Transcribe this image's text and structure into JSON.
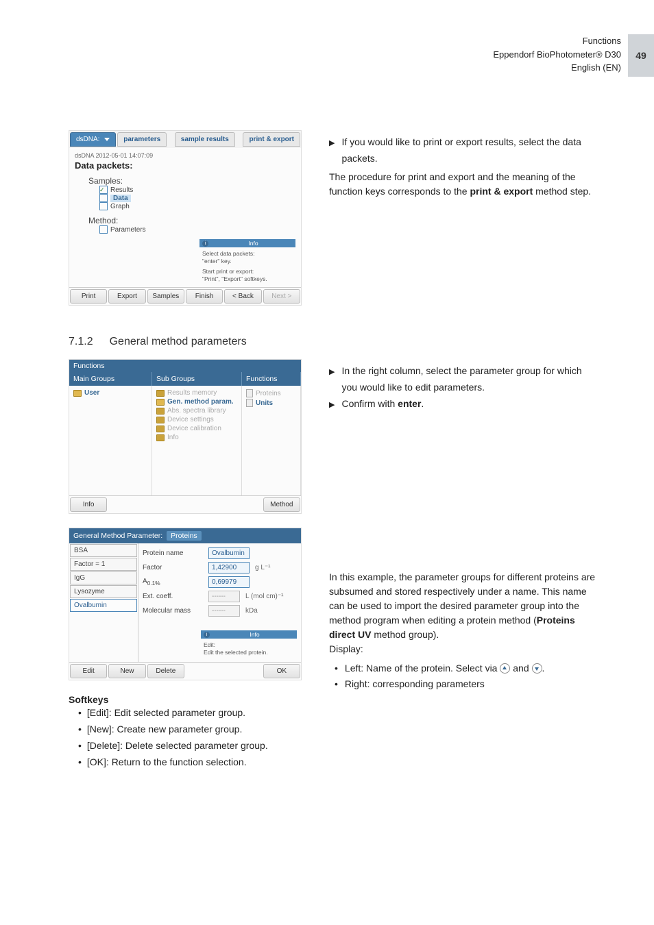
{
  "page": {
    "header_title": "Functions",
    "header_line2": "Eppendorf BioPhotometer® D30",
    "header_line3": "English (EN)",
    "page_number": "49"
  },
  "top_screenshot": {
    "tabs": {
      "method_name": "dsDNA:",
      "parameters": "parameters",
      "sample_results": "sample results",
      "print_export": "print & export"
    },
    "path_line": "dsDNA 2012-05-01 14:07:09",
    "data_packets_label": "Data packets:",
    "samples_label": "Samples:",
    "results_item": "Results",
    "data_item": "Data",
    "graph_item": "Graph",
    "method_label": "Method:",
    "parameters_item": "Parameters",
    "info": {
      "header": "Info",
      "line1": "Select data packets:",
      "line2": "\"enter\" key.",
      "line3": "Start print or export:",
      "line4": "\"Print\", \"Export\" softkeys."
    },
    "softkeys": {
      "print": "Print",
      "export": "Export",
      "samples": "Samples",
      "finish": "Finish",
      "back": "< Back",
      "next": "Next >"
    }
  },
  "top_right": {
    "step1_prefix": "If you would like to print or export results, select the data packets.",
    "para2_a": "The procedure for print and export and the meaning of the function keys corresponds to the ",
    "para2_b": "print & export",
    "para2_c": " method step."
  },
  "section_712": {
    "num": "7.1.2",
    "title": "General method parameters"
  },
  "func_shot": {
    "title": "Functions",
    "col1": "Main Groups",
    "col2": "Sub Groups",
    "col3": "Functions",
    "main_user": "User",
    "sub": {
      "results_memory": "Results memory",
      "gen_method": "Gen. method param.",
      "abs_spectra": "Abs. spectra library",
      "device_settings": "Device settings",
      "device_cal": "Device calibration",
      "info": "Info"
    },
    "func_proteins": "Proteins",
    "func_units": "Units",
    "softkeys": {
      "info": "Info",
      "method": "Method"
    }
  },
  "right_712_top": {
    "step1": "In the right column, select the parameter group for which you would like to edit parameters.",
    "step2_a": "Confirm with ",
    "step2_b": "enter",
    "step2_c": "."
  },
  "gmp_shot": {
    "title_a": "General Method Parameter:",
    "title_tag": "Proteins",
    "list": {
      "bsa": "BSA",
      "factor1": "Factor = 1",
      "igg": "IgG",
      "lysozyme": "Lysozyme",
      "ovalbumin": "Ovalbumin"
    },
    "params": {
      "name_label": "Protein name",
      "name_val": "Ovalbumin",
      "factor_label": "Factor",
      "factor_val": "1,42900",
      "factor_unit": "g L⁻¹",
      "a01_label": "A0.1%",
      "a01_val": "0,69979",
      "ext_label": "Ext. coeff.",
      "ext_val": "------",
      "ext_unit": "L (mol cm)⁻¹",
      "mm_label": "Molecular mass",
      "mm_val": "------",
      "mm_unit": "kDa"
    },
    "info": {
      "header": "Info",
      "line1": "Edit:",
      "line2": "Edit the selected protein."
    },
    "softkeys": {
      "edit": "Edit",
      "new": "New",
      "delete": "Delete",
      "ok": "OK"
    }
  },
  "right_gmp": {
    "para1": "In this example, the parameter groups for different proteins are subsumed and stored respectively under a name. This name can be used to import the desired parameter group into the method program when editing a protein method (",
    "para1_b": "Proteins direct UV",
    "para1_c": " method group).",
    "display_label": "Display:",
    "left_bullet_a": "Left: Name of the protein. Select via ",
    "left_bullet_b": " and ",
    "left_bullet_c": ".",
    "right_bullet": "Right: corresponding parameters"
  },
  "softkeys_section": {
    "heading": "Softkeys",
    "edit": "[Edit]: Edit selected parameter group.",
    "new": "[New]: Create new parameter group.",
    "delete": "[Delete]: Delete selected parameter group.",
    "ok": "[OK]: Return to the function selection."
  }
}
